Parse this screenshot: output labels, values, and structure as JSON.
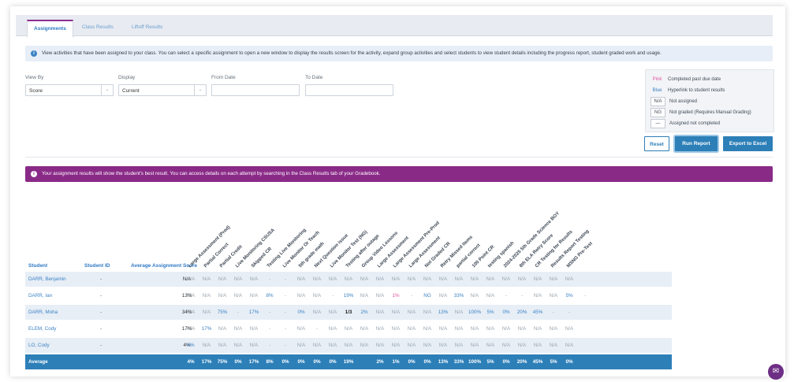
{
  "tabs": [
    {
      "label": "Assignments",
      "active": true
    },
    {
      "label": "Class Results",
      "active": false
    },
    {
      "label": "Liftoff Results",
      "active": false
    }
  ],
  "info_text": "View activities that have been assigned to your class. You can select a specific assignment to open a new window to display the results screen for the activity, expand group activities and select students to view student details including the progress report, student graded work and usage.",
  "filters": {
    "view_by": {
      "label": "View By",
      "value": "Score"
    },
    "display": {
      "label": "Display",
      "value": "Current"
    },
    "from_date": {
      "label": "From Date",
      "value": ""
    },
    "to_date": {
      "label": "To Date",
      "value": ""
    }
  },
  "legend": [
    {
      "key": "Pink",
      "text": "Completed past due date",
      "color": "#e0569f"
    },
    {
      "key": "Blue",
      "text": "Hyperlink to student results",
      "color": "#3b82c4"
    },
    {
      "key": "N/A",
      "text": "Not assigned",
      "color": "#444444"
    },
    {
      "key": "NG",
      "text": "Not graded (Requires Manual Grading)",
      "color": "#444444"
    },
    {
      "key": "—",
      "text": "Assigned not completed",
      "color": "#444444"
    }
  ],
  "buttons": {
    "reset": "Reset",
    "run_report": "Run Report",
    "export": "Export to Excel"
  },
  "banner_text": "Your assignment results will show the student's best result. You can access details on each attempt by searching in the Class Results tab of your Gradebook.",
  "table": {
    "headers": {
      "student": "Student",
      "student_id": "Student ID",
      "avg": "Average Assignment Score"
    },
    "assignments": [
      "Large Assessment (Prod)",
      "Partial Correct",
      "Partial Credit",
      "Live Monitoring CSUSA",
      "Skipped CR",
      "Testing Live Monitoring",
      "Live Monitor Or Teach",
      "5th grade math",
      "Next Question issue",
      "Live Monitor Test (NG)",
      "Testing after outage",
      "Group Video Lessons",
      "Large Assessment",
      "Large Assessment Pre-Prod",
      "Large Assessment",
      "Not Graded CR",
      "Retry Missed Items",
      "partial correct",
      "100 Point CR",
      "testing spanish",
      "2024-2025 5th Grade Science BOY",
      "8th ELA Retry Score",
      "CR Testing for Results",
      "Results Report Testing",
      "MSNG Pre-Test"
    ],
    "rows": [
      {
        "name": "DARR, Benjamin",
        "id": "-",
        "avg": "N/A",
        "scores": [
          "N/A",
          "N/A",
          "N/A",
          "N/A",
          "N/A",
          "-",
          "-",
          "N/A",
          "N/A",
          "N/A",
          "N/A",
          "N/A",
          "N/A",
          "N/A",
          "N/A",
          "N/A",
          "N/A",
          "N/A",
          "N/A",
          "N/A",
          "N/A",
          "N/A",
          "N/A",
          "N/A",
          "N/A"
        ],
        "styles": [
          "",
          "",
          "",
          "",
          "",
          "",
          "",
          "",
          "",
          "",
          "",
          "",
          "",
          "",
          "",
          "",
          "",
          "",
          "",
          "",
          "",
          "",
          "",
          "",
          ""
        ]
      },
      {
        "name": "DARR, Ian",
        "id": "-",
        "avg": "13%",
        "scores": [
          "N/A",
          "N/A",
          "N/A",
          "N/A",
          "N/A",
          "8%",
          "-",
          "N/A",
          "N/A",
          "-",
          "19%",
          "N/A",
          "N/A",
          "1%",
          "-",
          "NG",
          "N/A",
          "33%",
          "N/A",
          "N/A",
          "-",
          "-",
          "N/A",
          "N/A",
          "5%",
          "-"
        ],
        "styles": [
          "",
          "",
          "",
          "",
          "",
          "blue",
          "",
          "",
          "",
          "",
          "blue",
          "",
          "",
          "pink",
          "",
          "blue",
          "",
          "blue",
          "",
          "",
          "",
          "",
          "",
          "",
          "blue",
          ""
        ]
      },
      {
        "name": "DARR, Moha",
        "id": "-",
        "avg": "34%",
        "scores": [
          "N/A",
          "N/A",
          "75%",
          "-",
          "17%",
          "-",
          "-",
          "0%",
          "N/A",
          "N/A",
          "1/3",
          "2%",
          "N/A",
          "N/A",
          "N/A",
          "N/A",
          "13%",
          "N/A",
          "100%",
          "5%",
          "0%",
          "20%",
          "45%",
          "-",
          "-"
        ],
        "styles": [
          "",
          "",
          "blue",
          "",
          "blue",
          "",
          "",
          "blue",
          "",
          "",
          "bold",
          "blue",
          "",
          "",
          "",
          "",
          "blue",
          "",
          "blue",
          "blue",
          "blue",
          "blue",
          "blue",
          "",
          ""
        ]
      },
      {
        "name": "ELEM, Cody",
        "id": "-",
        "avg": "17%",
        "scores": [
          "N/A",
          "17%",
          "N/A",
          "N/A",
          "N/A",
          "-",
          "-",
          "N/A",
          "-",
          "N/A",
          "N/A",
          "N/A",
          "N/A",
          "N/A",
          "N/A",
          "N/A",
          "N/A",
          "N/A",
          "N/A",
          "N/A",
          "N/A",
          "N/A",
          "N/A",
          "N/A",
          "N/A"
        ],
        "styles": [
          "",
          "blue",
          "",
          "",
          "",
          "",
          "",
          "",
          "",
          "",
          "",
          "",
          "",
          "",
          "",
          "",
          "",
          "",
          "",
          "",
          "",
          "",
          "",
          "",
          ""
        ]
      },
      {
        "name": "LO, Cody",
        "id": "-",
        "avg": "4%",
        "scores": [
          "4%",
          "N/A",
          "N/A",
          "N/A",
          "N/A",
          "-",
          "-",
          "N/A",
          "N/A",
          "N/A",
          "N/A",
          "N/A",
          "N/A",
          "N/A",
          "N/A",
          "N/A",
          "N/A",
          "N/A",
          "N/A",
          "N/A",
          "N/A",
          "N/A",
          "N/A",
          "N/A",
          "N/A"
        ],
        "styles": [
          "blue",
          "",
          "",
          "",
          "",
          "",
          "",
          "",
          "",
          "",
          "",
          "",
          "",
          "",
          "",
          "",
          "",
          "",
          "",
          "",
          "",
          "",
          "",
          "",
          ""
        ]
      }
    ],
    "average": {
      "label": "Average",
      "scores": [
        "4%",
        "17%",
        "75%",
        "0%",
        "17%",
        "8%",
        "0%",
        "0%",
        "0%",
        "0%",
        "19%",
        "",
        "2%",
        "1%",
        "0%",
        "0%",
        "13%",
        "33%",
        "100%",
        "5%",
        "0%",
        "20%",
        "45%",
        "5%",
        "0%"
      ]
    }
  }
}
